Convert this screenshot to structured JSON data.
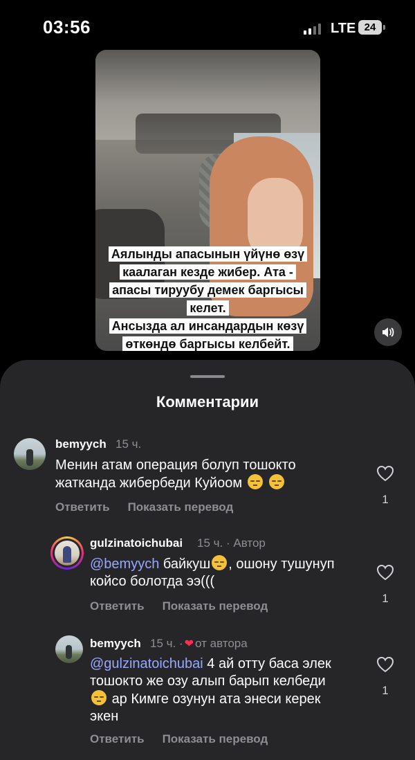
{
  "status_bar": {
    "time": "03:56",
    "network": "LTE",
    "battery": "24"
  },
  "video": {
    "caption_lines": [
      "Аялынды апасынын үйүнө өзү",
      "каалаган кезде жибер. Ата -",
      "апасы тируубу демек баргысы",
      "келет.",
      "Ансызда ал инсандардын көзү",
      "өткөндө баргысы келбейт."
    ],
    "sound_icon": "speaker-icon"
  },
  "sheet": {
    "title": "Комментарии"
  },
  "comments": [
    {
      "username": "bemyych",
      "time": "15 ч.",
      "text": "Менин атам операция болуп тошокто жатканда жибербеди Куйоом",
      "likes": "1",
      "reply_label": "Ответить",
      "translate_label": "Показать перевод"
    },
    {
      "username": "gulzinatoichubai",
      "time": "15 ч.",
      "author_sep": "·",
      "author_badge": "Автор",
      "mention": "@bemyych",
      "text_a": " байкуш",
      "text_b": ", ошону тушунуп койсо болотда ээ(((",
      "likes": "1",
      "reply_label": "Ответить",
      "translate_label": "Показать перевод"
    },
    {
      "username": "bemyych",
      "time": "15 ч.",
      "author_sep": "·",
      "liked_by_author": "от автора",
      "mention": "@gulzinatoichubai",
      "text_a": " 4 ай отту баса элек тошокто же озу алып барып келбеди ",
      "text_b": "ар Кимге озунун ата энеси керек экен",
      "likes": "1",
      "reply_label": "Ответить",
      "translate_label": "Показать перевод"
    }
  ],
  "colors": {
    "sheet_bg": "#262628",
    "mention": "#98a8ff",
    "heart_red": "#ff2d55"
  }
}
